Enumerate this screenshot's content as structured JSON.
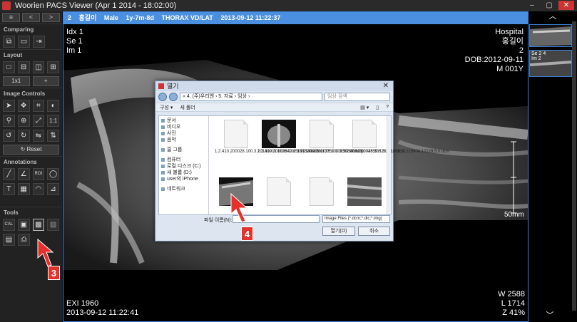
{
  "window": {
    "title": "Woorien PACS Viewer (Apr  1 2014 - 18:02:00)",
    "buttons": {
      "min": "–",
      "max": "▢",
      "close": "✕"
    }
  },
  "leftpanel": {
    "nav": [
      "<",
      ">"
    ],
    "sections": {
      "comparing": "Comparing",
      "layout": "Layout",
      "image_controls": "Image Controls",
      "annotations": "Annotations",
      "tools": "Tools"
    },
    "layout_buttons": [
      "1x1",
      "+"
    ],
    "reset": "Reset",
    "tool_labels": {
      "call": "CAL",
      "roi": "ROI",
      "scale": "1:1"
    }
  },
  "viewer": {
    "infobar": {
      "index": "2",
      "name": "홍길이",
      "sex": "Male",
      "age": "1y-7m-8d",
      "study": "THORAX VD/LAT",
      "datetime": "2013-09-12   11:22:37"
    },
    "overlay": {
      "tl": [
        "Idx 1",
        "Se 1",
        "Im 1"
      ],
      "tr": [
        "Hospital",
        "홍길이",
        "2",
        "DOB:2012-09-11",
        "M 001Y"
      ],
      "bl": [
        "EXI 1960",
        "2013-09-12  11:22:41"
      ],
      "br": [
        "W 2588",
        "L 1714",
        "Z 41%"
      ],
      "ruler": "50mm"
    }
  },
  "dialog": {
    "title": "열기",
    "path": "« 4. (주)우리엔  ›  5. 자료  ›  임상  ›",
    "search_placeholder": "임상 검색",
    "cmd": {
      "organize": "구성 ▾",
      "new_folder": "새 폴더"
    },
    "nav": {
      "docs": "문서",
      "videos": "비디오",
      "pictures": "사진",
      "music": "음악",
      "homegroup": "홈 그룹",
      "computer": "컴퓨터",
      "local_c": "로컬 디스크 (C:)",
      "new_d": "새 볼륨 (D:)",
      "iphone": "user의 iPhone",
      "network": "네트워크"
    },
    "files": [
      {
        "kind": "doc",
        "name": "1.2.410.200028.100.3.20130911.103649.15891.1.0.dcm"
      },
      {
        "kind": "xray",
        "name": "1.2.410.200028.100.3.20130911.113759.10850.3.0.bmp"
      },
      {
        "kind": "doc",
        "name": "1.2.410.200028.100.3.20130912.004559.5281.1.0.dcm"
      },
      {
        "kind": "doc",
        "name": "1.2.410.200028.100.3.20130912.115904.12129.5.0.dcm"
      },
      {
        "kind": "xray2",
        "name": ""
      },
      {
        "kind": "doc",
        "name": ""
      },
      {
        "kind": "doc",
        "name": ""
      },
      {
        "kind": "xray3",
        "name": ""
      }
    ],
    "filename_label": "파일 이름(N):",
    "filetype": "Image Files (*.dcm;*.dic;*.img)",
    "open": "열기(O)",
    "cancel": "취소"
  },
  "markers": {
    "m3": "3",
    "m4": "4"
  },
  "rightpanel": {
    "up": "︿",
    "down": "﹀",
    "thumb2": {
      "line1": "Se 2 4",
      "line2": "Im 2"
    }
  },
  "colors": {
    "accent": "#4a8fe0",
    "marker": "#e4312b"
  }
}
